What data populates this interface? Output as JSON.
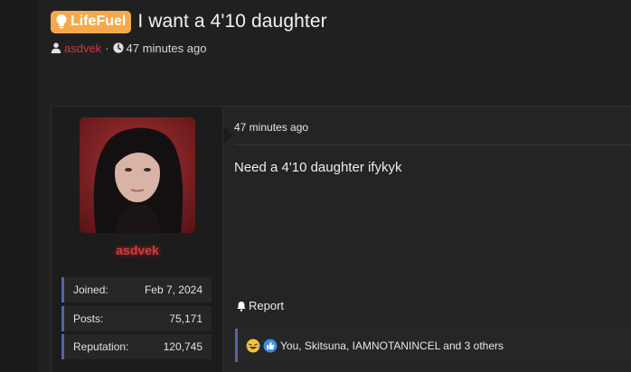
{
  "thread": {
    "prefix": "LifeFuel",
    "title": "I want a 4'10 daughter",
    "author": "asdvek",
    "time_ago": "47 minutes ago"
  },
  "post": {
    "user": {
      "username": "asdvek",
      "stats": [
        {
          "label": "Joined:",
          "value": "Feb 7, 2024"
        },
        {
          "label": "Posts:",
          "value": "75,171"
        },
        {
          "label": "Reputation:",
          "value": "120,745"
        }
      ]
    },
    "time_ago": "47 minutes ago",
    "body": "Need a 4'10 daughter ifykyk",
    "report_label": "Report",
    "reactions_text": "You, Skitsuna, IAMNOTANINCEL and 3 others"
  },
  "colors": {
    "prefix_badge": "#f6a94a",
    "username": "#d73b3f",
    "accent_border": "#5664a8"
  }
}
